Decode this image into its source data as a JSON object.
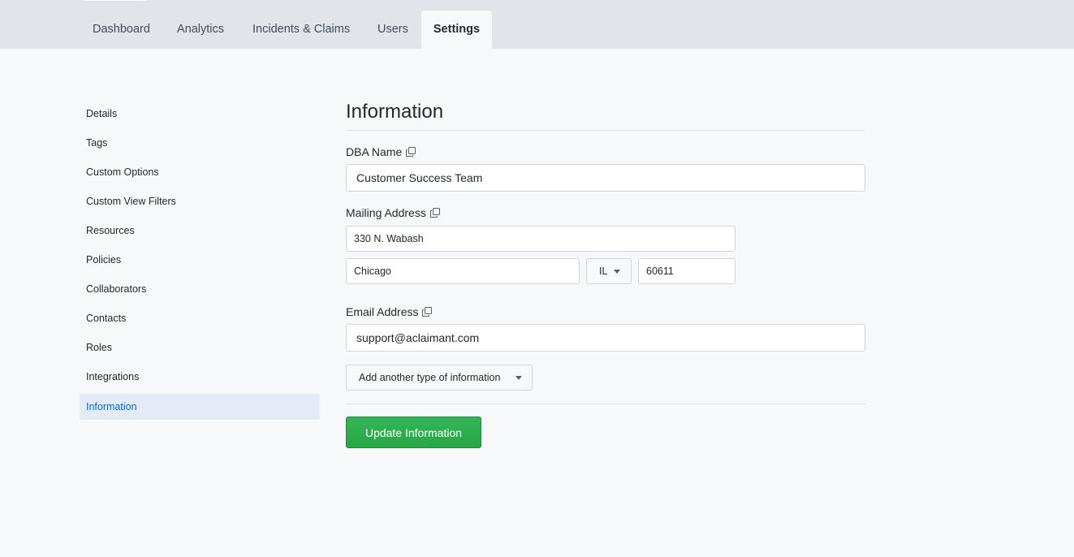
{
  "nav": {
    "tabs": [
      {
        "label": "Dashboard"
      },
      {
        "label": "Analytics"
      },
      {
        "label": "Incidents & Claims"
      },
      {
        "label": "Users"
      },
      {
        "label": "Settings",
        "active": true
      }
    ]
  },
  "sidebar": {
    "items": [
      {
        "label": "Details"
      },
      {
        "label": "Tags"
      },
      {
        "label": "Custom Options"
      },
      {
        "label": "Custom View Filters"
      },
      {
        "label": "Resources"
      },
      {
        "label": "Policies"
      },
      {
        "label": "Collaborators"
      },
      {
        "label": "Contacts"
      },
      {
        "label": "Roles"
      },
      {
        "label": "Integrations"
      },
      {
        "label": "Information",
        "active": true
      }
    ]
  },
  "form": {
    "title": "Information",
    "dba_label": "DBA Name",
    "dba_value": "Customer Success Team",
    "mailing_label": "Mailing Address",
    "street_value": "330 N. Wabash",
    "city_value": "Chicago",
    "state_value": "IL",
    "zip_value": "60611",
    "email_label": "Email Address",
    "email_value": "support@aclaimant.com",
    "add_type_label": "Add another type of information",
    "submit_label": "Update Information"
  },
  "colors": {
    "accent": "#0366d6",
    "submit": "#28a745",
    "active_sidebar_bg": "#e3ecf6"
  },
  "icons": {
    "copy": "copy-icon",
    "caret": "chevron-down-icon"
  }
}
